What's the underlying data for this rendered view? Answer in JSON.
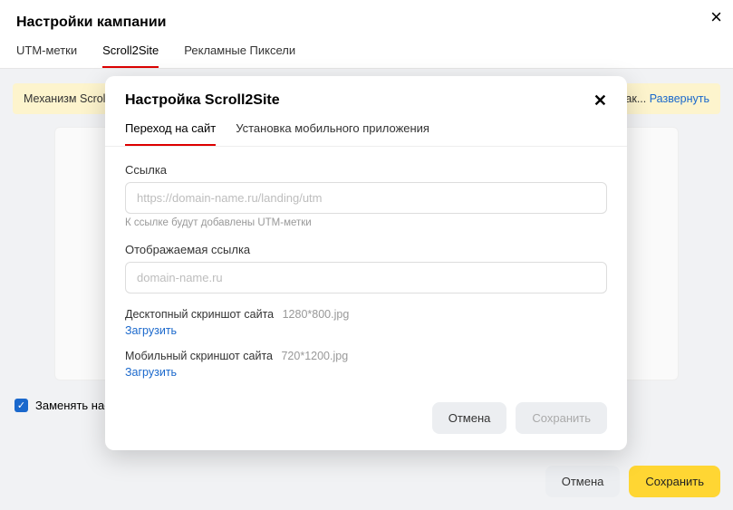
{
  "page": {
    "title": "Настройки кампании",
    "tabs": [
      {
        "label": "UTM-метки"
      },
      {
        "label": "Scroll2Site"
      },
      {
        "label": "Рекламные Пиксели"
      }
    ],
    "active_tab_index": 1,
    "info_text": "Механизм Scroll2",
    "info_trail": "ак...",
    "expand_label": "Развернуть",
    "checkbox_label": "Заменять настройки Scroll2Site, ранее проставленные в публикациях, на данные настройки.",
    "checkbox_checked": true,
    "footer": {
      "cancel": "Отмена",
      "save": "Сохранить"
    }
  },
  "modal": {
    "title": "Настройка Scroll2Site",
    "tabs": [
      {
        "label": "Переход на сайт"
      },
      {
        "label": "Установка мобильного приложения"
      }
    ],
    "active_tab_index": 0,
    "link": {
      "label": "Ссылка",
      "placeholder": "https://domain-name.ru/landing/utm",
      "value": "",
      "hint": "К ссылке будут добавлены UTM-метки"
    },
    "display_link": {
      "label": "Отображаемая ссылка",
      "placeholder": "domain-name.ru",
      "value": ""
    },
    "desktop_shot": {
      "label": "Десктопный скриншот сайта",
      "filename": "1280*800.jpg",
      "upload": "Загрузить"
    },
    "mobile_shot": {
      "label": "Мобильный скриншот сайта",
      "filename": "720*1200.jpg",
      "upload": "Загрузить"
    },
    "footer": {
      "cancel": "Отмена",
      "save": "Сохранить"
    }
  }
}
